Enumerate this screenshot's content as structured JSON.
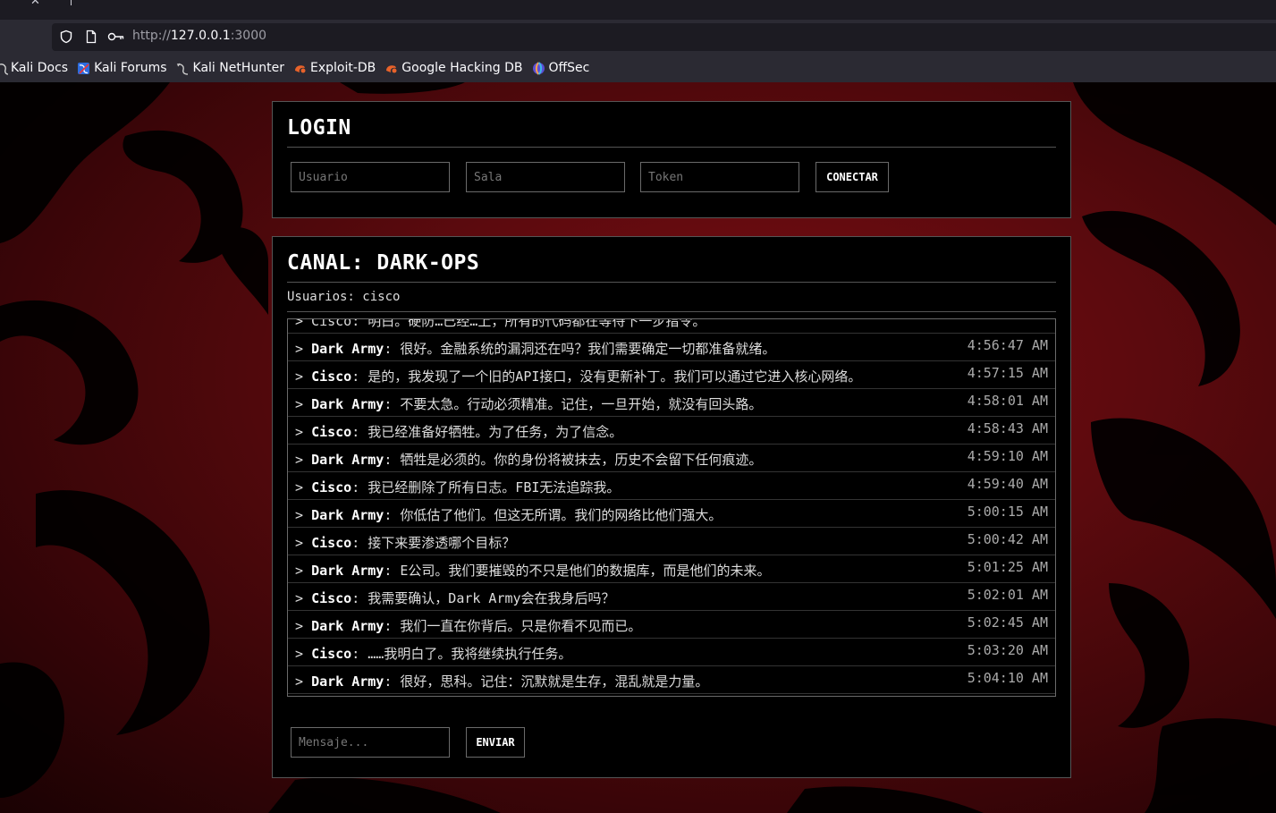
{
  "browser": {
    "url_scheme": "http://",
    "url_host": "127.0.0.1",
    "url_port": ":3000",
    "bookmarks": [
      {
        "label": "Kali Docs",
        "icon": "kali-dragon-icon"
      },
      {
        "label": "Kali Forums",
        "icon": "kali-forums-icon"
      },
      {
        "label": "Kali NetHunter",
        "icon": "kali-dragon-icon"
      },
      {
        "label": "Exploit-DB",
        "icon": "exploit-db-icon"
      },
      {
        "label": "Google Hacking DB",
        "icon": "exploit-db-icon"
      },
      {
        "label": "OffSec",
        "icon": "offsec-icon"
      }
    ]
  },
  "login": {
    "title": "LOGIN",
    "user_placeholder": "Usuario",
    "room_placeholder": "Sala",
    "token_placeholder": "Token",
    "connect_label": "CONECTAR"
  },
  "channel": {
    "title": "CANAL: DARK-OPS",
    "users_label": "Usuarios: cisco",
    "partial_line": "> Cisco: 明白。硬防…已经…上，所有的代码都在等待下一步指令。",
    "messages": [
      {
        "author": "Dark Army",
        "text": "很好。金融系统的漏洞还在吗？我们需要确定一切都准备就绪。",
        "time": "4:56:47 AM"
      },
      {
        "author": "Cisco",
        "text": "是的，我发现了一个旧的API接口，没有更新补丁。我们可以通过它进入核心网络。",
        "time": "4:57:15 AM"
      },
      {
        "author": "Dark Army",
        "text": "不要太急。行动必须精准。记住，一旦开始，就没有回头路。",
        "time": "4:58:01 AM"
      },
      {
        "author": "Cisco",
        "text": "我已经准备好牺牲。为了任务，为了信念。",
        "time": "4:58:43 AM"
      },
      {
        "author": "Dark Army",
        "text": "牺牲是必须的。你的身份将被抹去，历史不会留下任何痕迹。",
        "time": "4:59:10 AM"
      },
      {
        "author": "Cisco",
        "text": "我已经删除了所有日志。FBI无法追踪我。",
        "time": "4:59:40 AM"
      },
      {
        "author": "Dark Army",
        "text": "你低估了他们。但这无所谓。我们的网络比他们强大。",
        "time": "5:00:15 AM"
      },
      {
        "author": "Cisco",
        "text": "接下来要渗透哪个目标？",
        "time": "5:00:42 AM"
      },
      {
        "author": "Dark Army",
        "text": "E公司。我们要摧毁的不只是他们的数据库，而是他们的未来。",
        "time": "5:01:25 AM"
      },
      {
        "author": "Cisco",
        "text": "我需要确认，Dark Army会在我身后吗？",
        "time": "5:02:01 AM"
      },
      {
        "author": "Dark Army",
        "text": "我们一直在你背后。只是你看不见而已。",
        "time": "5:02:45 AM"
      },
      {
        "author": "Cisco",
        "text": "……我明白了。我将继续执行任务。",
        "time": "5:03:20 AM"
      },
      {
        "author": "Dark Army",
        "text": "很好，思科。记住：沉默就是生存，混乱就是力量。",
        "time": "5:04:10 AM"
      }
    ],
    "message_placeholder": "Mensaje...",
    "send_label": "ENVIAR"
  }
}
